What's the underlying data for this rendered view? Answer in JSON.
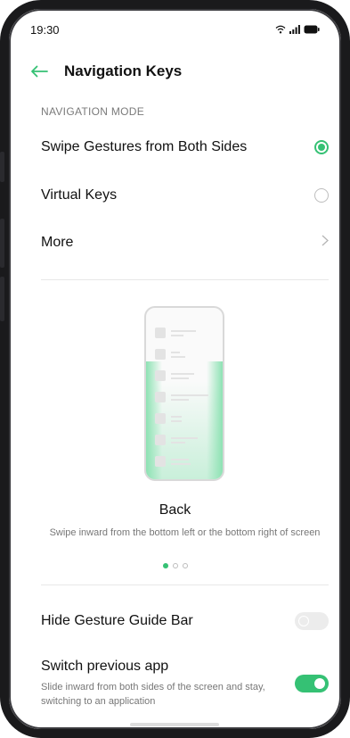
{
  "status_bar": {
    "time": "19:30",
    "icons": [
      "wifi-icon",
      "signal-icon",
      "battery-icon"
    ]
  },
  "app_bar": {
    "title": "Navigation Keys",
    "back_icon": "back-arrow-icon"
  },
  "navigation_mode": {
    "section_label": "NAVIGATION MODE",
    "options": [
      {
        "label": "Swipe Gestures from Both Sides",
        "selected": true
      },
      {
        "label": "Virtual Keys",
        "selected": false
      }
    ],
    "more_label": "More"
  },
  "guide": {
    "title": "Back",
    "description": "Swipe inward from the bottom left or the bottom right of screen",
    "page_count": 3,
    "current_page": 1
  },
  "settings": {
    "hide_guide_bar": {
      "label": "Hide Gesture Guide Bar",
      "enabled": false
    },
    "switch_previous_app": {
      "label": "Switch previous app",
      "description": "Slide inward from both sides of the screen and stay, switching to an application",
      "enabled": true
    }
  },
  "colors": {
    "accent": "#35c174",
    "text": "#111111",
    "secondary_text": "#777777"
  }
}
